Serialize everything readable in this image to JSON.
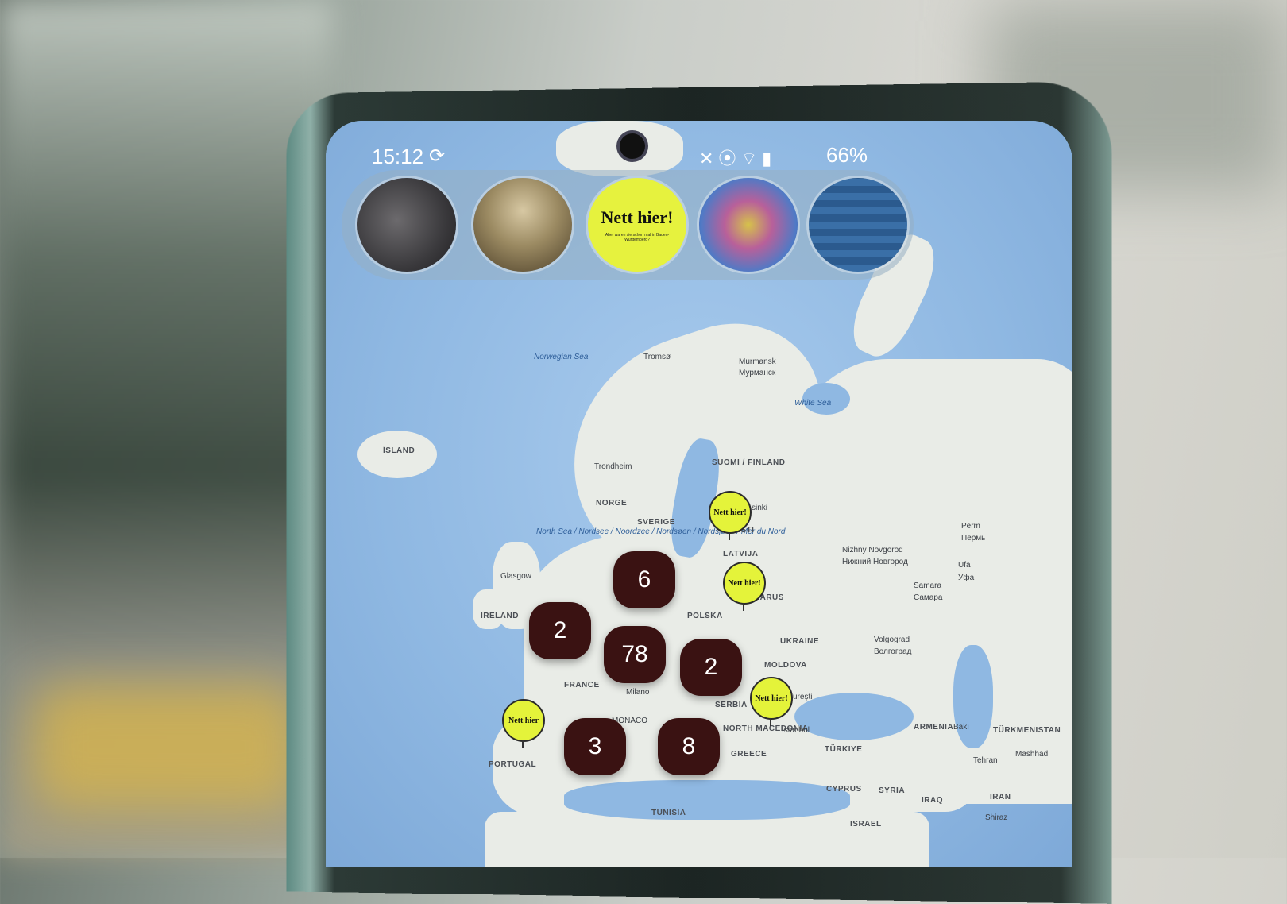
{
  "status_bar": {
    "time": "15:12",
    "battery": "66%"
  },
  "stories": [
    {
      "name": "story-portrait-dark"
    },
    {
      "name": "story-mona-lisa"
    },
    {
      "name": "story-nett-hier",
      "title": "Nett hier!",
      "subtitle": "Aber waren sie schon mal in Baden-Württemberg?"
    },
    {
      "name": "story-eye-painting"
    },
    {
      "name": "story-blue-pattern"
    }
  ],
  "map_labels": {
    "norwegian_sea": "Norwegian Sea",
    "tromso": "Tromsø",
    "murmansk": "Murmansk",
    "murmansk_cyr": "Мурманск",
    "white_sea": "White Sea",
    "iceland": "ÍSLAND",
    "trondheim": "Trondheim",
    "finland": "SUOMI / FINLAND",
    "norge": "NORGE",
    "sverige": "SVERIGE",
    "north_sea": "North Sea / Nordsee / Noordzee / Nordsøen / Nordsjøen / Mer du Nord",
    "glasgow": "Glasgow",
    "ireland": "IRELAND",
    "latvija": "LATVIJA",
    "belarus": "LARUS",
    "polska": "POLSKA",
    "france": "FRANCE",
    "milano": "Milano",
    "ukraine": "UKRAINE",
    "moldova": "MOLDOVA",
    "serbia": "SERBIA",
    "portugal": "PORTUGAL",
    "north_macedonia": "NORTH MACEDONIA",
    "greece": "GREECE",
    "istanbul": "İstanbul",
    "turkiye": "TÜRKIYE",
    "nizhny": "Nizhny Novgorod",
    "nizhny_cyr": "Нижний Новгород",
    "perm": "Perm",
    "perm_cyr": "Пермь",
    "ufa": "Ufa",
    "ufa_cyr": "Уфа",
    "samara": "Samara",
    "samara_cyr": "Самара",
    "volgograd": "Volgograd",
    "volgograd_cyr": "Волгоград",
    "armenia": "ARMENIA",
    "baki": "Bakı",
    "turkmenistan": "TÜRKMENISTAN",
    "tehran": "Tehran",
    "mashhad": "Mashhad",
    "iran": "IRAN",
    "syria": "SYRIA",
    "iraq": "IRAQ",
    "cyprus": "CYPRUS",
    "israel": "ISRAEL",
    "tunisia": "TUNISIA",
    "shiraz": "Shiraz",
    "monaco": "MONACO",
    "esti": "EESTI",
    "helsinki": "sinki",
    "bucuresti": "urești"
  },
  "clusters": [
    {
      "count": "6"
    },
    {
      "count": "2"
    },
    {
      "count": "78"
    },
    {
      "count": "2"
    },
    {
      "count": "3"
    },
    {
      "count": "8"
    }
  ],
  "pins": [
    {
      "label": "Nett hier!"
    },
    {
      "label": "Nett hier!"
    },
    {
      "label": "Nett hier!"
    },
    {
      "label": "Nett hier"
    }
  ]
}
